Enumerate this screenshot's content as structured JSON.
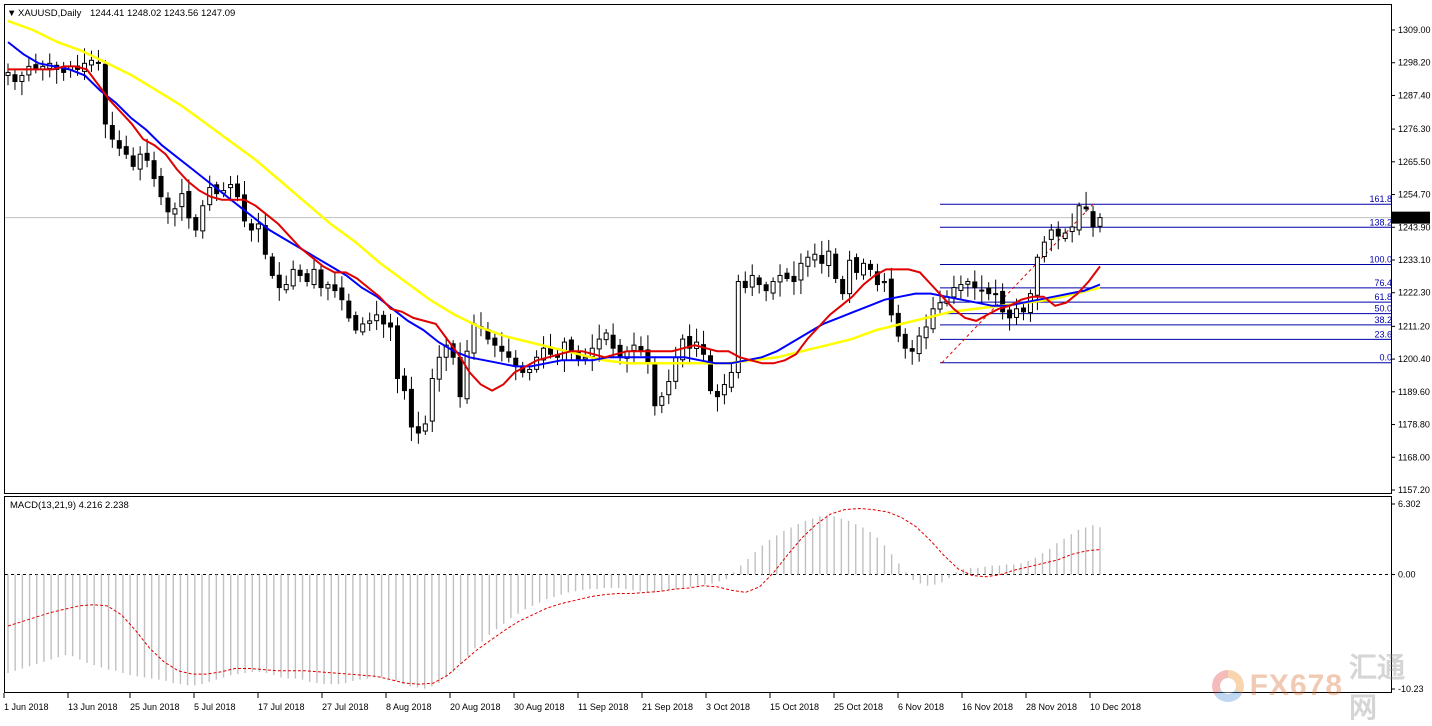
{
  "header": {
    "symbol": "XAUUSD,Daily",
    "ohlc": "1244.41 1248.02 1243.56 1247.09",
    "menu_glyph": "▼"
  },
  "watermark": {
    "brand": "FX678",
    "cn": "汇通网"
  },
  "colors": {
    "ma_red": "#e00000",
    "ma_blue": "#0000ff",
    "ma_yellow": "#ffff00",
    "fib": "#0000aa",
    "price_line": "#c0c0c0",
    "macd_hist": "#c0c0c0",
    "macd_signal": "#e00000"
  },
  "chart_data": [
    {
      "type": "candlestick",
      "title": "XAUUSD,Daily",
      "ylim": [
        1157.2,
        1314.0
      ],
      "y_ticks": [
        "1309.00",
        "1298.20",
        "1287.40",
        "1276.30",
        "1265.50",
        "1254.70",
        "1243.90",
        "1233.10",
        "1222.30",
        "1211.20",
        "1200.40",
        "1189.60",
        "1178.80",
        "1168.00",
        "1157.20"
      ],
      "x_ticks": [
        "1 Jun 2018",
        "13 Jun 2018",
        "25 Jun 2018",
        "5 Jul 2018",
        "17 Jul 2018",
        "27 Jul 2018",
        "8 Aug 2018",
        "20 Aug 2018",
        "30 Aug 2018",
        "11 Sep 2018",
        "21 Sep 2018",
        "3 Oct 2018",
        "15 Oct 2018",
        "25 Oct 2018",
        "6 Nov 2018",
        "16 Nov 2018",
        "28 Nov 2018",
        "10 Dec 2018"
      ],
      "current_price": {
        "label": "1247.08",
        "value": 1247.08
      },
      "close": [
        1295,
        1292,
        1294,
        1297,
        1296,
        1297,
        1298,
        1296,
        1295,
        1297,
        1296,
        1298,
        1299,
        1298,
        1278,
        1273,
        1270,
        1268,
        1264,
        1268,
        1266,
        1260,
        1254,
        1249,
        1250,
        1255,
        1247,
        1243,
        1251,
        1257,
        1255,
        1256,
        1258,
        1254,
        1246,
        1243,
        1245,
        1235,
        1228,
        1224,
        1225,
        1230,
        1228,
        1226,
        1230,
        1224,
        1225,
        1223,
        1220,
        1214,
        1210,
        1212,
        1213,
        1215,
        1212,
        1211,
        1194,
        1190,
        1178,
        1176,
        1179,
        1194,
        1201,
        1205,
        1201,
        1188,
        1203,
        1212,
        1211,
        1207,
        1205,
        1203,
        1201,
        1198,
        1196,
        1197,
        1201,
        1204,
        1202,
        1201,
        1206,
        1203,
        1200,
        1201,
        1204,
        1207,
        1209,
        1204,
        1201,
        1203,
        1205,
        1203,
        1199,
        1185,
        1188,
        1193,
        1201,
        1207,
        1204,
        1206,
        1202,
        1190,
        1188,
        1192,
        1196,
        1226,
        1224,
        1228,
        1225,
        1223,
        1226,
        1228,
        1227,
        1226,
        1232,
        1234,
        1235,
        1232,
        1236,
        1227,
        1222,
        1233,
        1229,
        1232,
        1230,
        1225,
        1226,
        1215,
        1208,
        1204,
        1203,
        1208,
        1211,
        1217,
        1219,
        1221,
        1224,
        1225,
        1226,
        1224,
        1223,
        1222,
        1222,
        1216,
        1214,
        1217,
        1216,
        1222,
        1234,
        1239,
        1243,
        1241,
        1242,
        1244,
        1251,
        1250,
        1244,
        1247.09
      ],
      "ma_fast": {
        "name": "",
        "values": [
          1296,
          1296,
          1296,
          1296,
          1296,
          1297,
          1297,
          1296,
          1291,
          1286,
          1282,
          1278,
          1273,
          1271,
          1268,
          1263,
          1259,
          1256,
          1254,
          1253,
          1253,
          1253,
          1251,
          1248,
          1245,
          1241,
          1237,
          1234,
          1231,
          1229,
          1229,
          1227,
          1224,
          1221,
          1217,
          1216,
          1214,
          1213,
          1212,
          1207,
          1202,
          1196,
          1192,
          1190,
          1192,
          1196,
          1198,
          1200,
          1201,
          1202,
          1203,
          1203,
          1202,
          1201,
          1202,
          1203,
          1203,
          1203,
          1203,
          1203,
          1204,
          1205,
          1204,
          1203,
          1203,
          1201,
          1200,
          1199,
          1199,
          1200,
          1202,
          1207,
          1211,
          1215,
          1218,
          1221,
          1225,
          1228,
          1230,
          1230,
          1230,
          1229,
          1225,
          1221,
          1217,
          1214,
          1213,
          1215,
          1217,
          1218,
          1220,
          1221,
          1221,
          1218,
          1219,
          1222,
          1226,
          1231
        ]
      },
      "ma_mid": {
        "name": "",
        "values": [
          1305,
          1301,
          1298,
          1297,
          1296,
          1294,
          1289,
          1285,
          1280,
          1276,
          1271,
          1267,
          1263,
          1259,
          1255,
          1251,
          1247,
          1243,
          1240,
          1237,
          1234,
          1231,
          1228,
          1224,
          1221,
          1217,
          1213,
          1210,
          1206,
          1203,
          1201,
          1200,
          1199,
          1198,
          1198,
          1199,
          1200,
          1200,
          1200,
          1201,
          1201,
          1201,
          1201,
          1201,
          1201,
          1200,
          1199,
          1199,
          1200,
          1201,
          1203,
          1206,
          1209,
          1212,
          1214,
          1216,
          1218,
          1220,
          1221,
          1222,
          1222,
          1221,
          1220,
          1219,
          1218,
          1218,
          1219,
          1220,
          1221,
          1222,
          1223,
          1225
        ]
      },
      "ma_slow": {
        "name": "",
        "values": [
          1312,
          1309,
          1305,
          1302,
          1298,
          1294,
          1289,
          1284,
          1278,
          1272,
          1266,
          1259,
          1252,
          1245,
          1239,
          1232,
          1226,
          1220,
          1215,
          1211,
          1208,
          1206,
          1204,
          1202,
          1200,
          1199,
          1199,
          1199,
          1199,
          1199,
          1200,
          1201,
          1203,
          1205,
          1207,
          1210,
          1212,
          1214,
          1216,
          1217,
          1218,
          1219,
          1220,
          1222,
          1224
        ]
      },
      "fibonacci": [
        {
          "level": "161.8",
          "price": 1251.5
        },
        {
          "level": "138.2",
          "price": 1243.9
        },
        {
          "level": "100.0",
          "price": 1231.6
        },
        {
          "level": "76.4",
          "price": 1223.9
        },
        {
          "level": "61.8",
          "price": 1219.2
        },
        {
          "level": "50.0",
          "price": 1215.4
        },
        {
          "level": "38.2",
          "price": 1211.7
        },
        {
          "level": "23.6",
          "price": 1206.9
        },
        {
          "level": "0.0",
          "price": 1199.2
        }
      ]
    },
    {
      "type": "bar",
      "title": "MACD(13,21,9) 4.216 2.238",
      "ylim": [
        -10.23,
        6.302
      ],
      "y_ticks": [
        "6.302",
        "0.00",
        "-10.23"
      ],
      "histogram": [
        -8.8,
        -8.6,
        -8.4,
        -8.2,
        -8.0,
        -7.8,
        -7.6,
        -7.4,
        -7.2,
        -7.3,
        -7.6,
        -7.9,
        -8.1,
        -8.3,
        -8.5,
        -8.6,
        -8.8,
        -9.0,
        -9.1,
        -9.2,
        -9.3,
        -9.4,
        -9.5,
        -9.7,
        -9.8,
        -9.9,
        -9.9,
        -9.8,
        -9.6,
        -9.4,
        -9.2,
        -9.0,
        -8.9,
        -8.8,
        -8.7,
        -8.7,
        -8.8,
        -9.0,
        -9.2,
        -9.3,
        -9.3,
        -9.4,
        -9.6,
        -9.7,
        -9.8,
        -9.8,
        -9.8,
        -9.7,
        -9.5,
        -9.4,
        -9.3,
        -9.2,
        -9.2,
        -9.3,
        -9.5,
        -9.8,
        -10.0,
        -10.1,
        -10.2,
        -10.0,
        -9.7,
        -9.2,
        -8.7,
        -8.0,
        -7.3,
        -6.6,
        -6.0,
        -5.4,
        -4.9,
        -4.4,
        -3.9,
        -3.5,
        -3.1,
        -2.8,
        -2.5,
        -2.2,
        -2.0,
        -1.8,
        -1.6,
        -1.5,
        -1.4,
        -1.3,
        -1.3,
        -1.2,
        -1.2,
        -1.2,
        -1.3,
        -1.4,
        -1.5,
        -1.6,
        -1.6,
        -1.5,
        -1.4,
        -1.3,
        -1.2,
        -1.1,
        -1.0,
        -0.9,
        -0.8,
        -0.6,
        -0.4,
        0.2,
        0.8,
        1.4,
        2.0,
        2.6,
        3.1,
        3.5,
        3.9,
        4.2,
        4.5,
        4.8,
        5.0,
        5.2,
        5.3,
        5.2,
        5.0,
        4.8,
        4.5,
        4.2,
        3.8,
        3.3,
        2.6,
        1.8,
        1.0,
        0.2,
        -0.5,
        -0.8,
        -1.0,
        -0.9,
        -0.7,
        -0.3,
        0.2,
        0.5,
        0.6,
        0.6,
        0.7,
        0.8,
        0.8,
        0.9,
        0.9,
        1.0,
        1.2,
        1.5,
        1.9,
        2.3,
        2.8,
        3.2,
        3.6,
        4.0,
        4.2,
        4.4,
        4.216
      ],
      "signal": [
        -4.6,
        -4.2,
        -3.8,
        -3.4,
        -3.1,
        -2.8,
        -2.7,
        -2.8,
        -3.6,
        -5.0,
        -6.6,
        -7.8,
        -8.6,
        -8.9,
        -8.9,
        -8.7,
        -8.4,
        -8.4,
        -8.5,
        -8.6,
        -8.6,
        -8.6,
        -8.7,
        -8.8,
        -8.9,
        -9.0,
        -9.1,
        -9.4,
        -9.7,
        -9.8,
        -9.7,
        -9.0,
        -7.9,
        -6.8,
        -5.9,
        -5.0,
        -4.2,
        -3.6,
        -3.0,
        -2.6,
        -2.3,
        -2.0,
        -1.8,
        -1.7,
        -1.7,
        -1.6,
        -1.5,
        -1.3,
        -1.2,
        -1.0,
        -1.1,
        -1.4,
        -1.6,
        -1.1,
        0.2,
        1.8,
        3.3,
        4.5,
        5.4,
        5.8,
        5.9,
        5.8,
        5.6,
        5.1,
        4.3,
        3.1,
        1.7,
        0.5,
        -0.1,
        -0.2,
        0.0,
        0.4,
        0.7,
        1.0,
        1.3,
        1.8,
        2.1,
        2.238
      ]
    }
  ]
}
